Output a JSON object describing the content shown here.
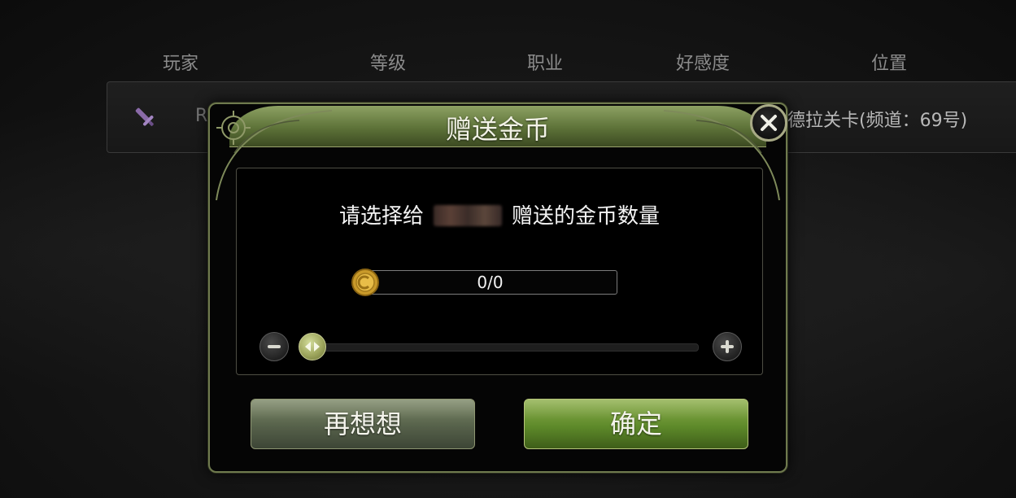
{
  "table_header": {
    "player": "玩家",
    "level": "等级",
    "class": "职业",
    "favor": "好感度",
    "location": "位置"
  },
  "player_row": {
    "name_partial": "R",
    "location": "德拉关卡(频道：69号)"
  },
  "dialog": {
    "title": "赠送金币",
    "prompt_before": "请选择给",
    "prompt_after": "赠送的金币数量",
    "amount_display": "0/0",
    "slider_value": 0,
    "cancel_label": "再想想",
    "confirm_label": "确定"
  },
  "colors": {
    "title_bar": "#5d7238",
    "confirm_button": "#5e8a2a",
    "cancel_button": "#56614a",
    "frame_border": "#6f7a4e"
  },
  "icons": {
    "row_class_icon": "sword-icon",
    "currency_icon": "gold-coin-icon",
    "close_icon": "close-icon",
    "minus_icon": "minus-icon",
    "plus_icon": "plus-icon",
    "slider_thumb_icon": "double-arrow-icon"
  }
}
